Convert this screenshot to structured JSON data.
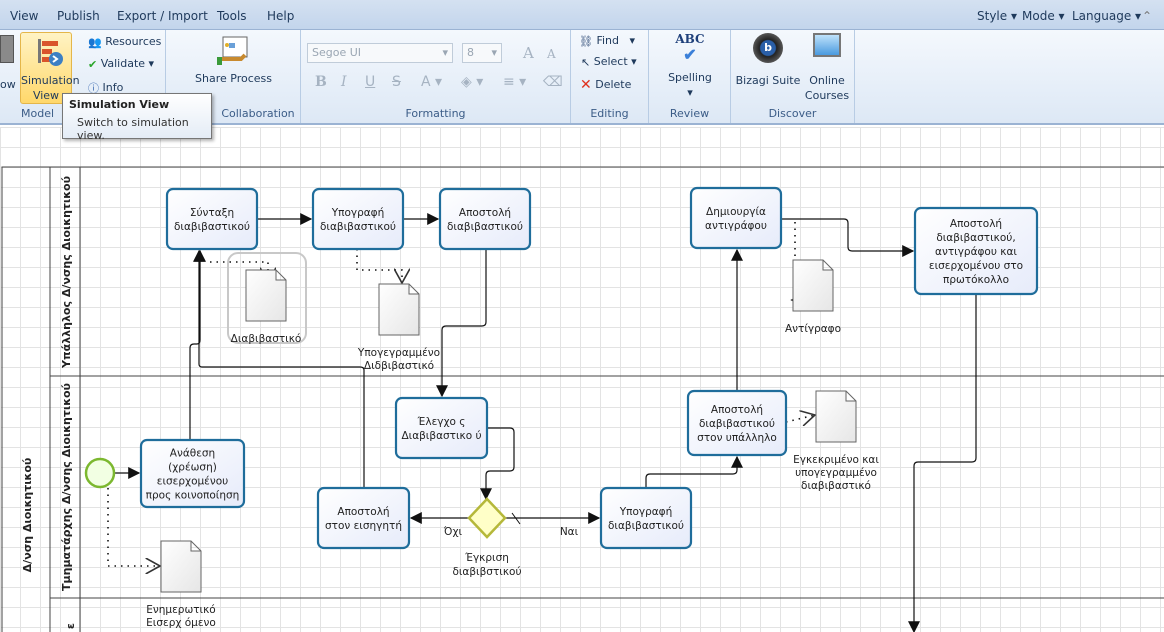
{
  "menu": {
    "items": [
      "View",
      "Publish",
      "Export / Import",
      "Tools",
      "Help"
    ],
    "right": [
      "Style",
      "Mode",
      "Language"
    ]
  },
  "ribbon": {
    "model": {
      "partial_label": "ow",
      "simulation": [
        "Simulation",
        "View"
      ],
      "resources": "Resources",
      "validate": "Validate",
      "info": "Info",
      "group": "Model"
    },
    "collaboration": {
      "share": "Share Process",
      "group": "Collaboration"
    },
    "formatting": {
      "font": "Segoe UI",
      "size": "8",
      "group": "Formatting"
    },
    "editing": {
      "find": "Find",
      "select": "Select",
      "delete": "Delete",
      "group": "Editing"
    },
    "review": {
      "spelling": "Spelling",
      "group": "Review"
    },
    "discover": {
      "suite": "Bizagi Suite",
      "courses": [
        "Online",
        "Courses"
      ],
      "group": "Discover"
    }
  },
  "tooltip": {
    "title": "Simulation View",
    "text": "Switch to simulation view."
  },
  "diagram": {
    "pool": "Δ/νση Διοικητικού",
    "lanes": [
      "Υπάλληλος Δ/νσης Διοικητικού",
      "Τμηματάρχης Δ/νσης Διοικητικού",
      "ε"
    ],
    "tasks": [
      [
        "Σύνταξη",
        "διαβιβαστικού"
      ],
      [
        "Υπογραφή",
        "διαβιβαστικού"
      ],
      [
        "Αποστολή",
        "διαβιβαστικού"
      ],
      [
        "Δημιουργία",
        "αντιγράφου"
      ],
      [
        "Αποστολή",
        "διαβιβαστικού,",
        "αντιγράφου και",
        "εισερχομένου στο",
        "πρωτόκολλο"
      ],
      [
        "Ανάθεση",
        "(χρέωση)",
        "εισερχομένου",
        "προς κοινοποίηση"
      ],
      [
        "Έλεγχο ς",
        "Διαβιβαστικο ύ"
      ],
      [
        "Αποστολή",
        "στον  εισηγητή"
      ],
      [
        "Υπογραφή",
        "διαβιβαστικού"
      ],
      [
        "Αποστολή",
        "διαβιβαστικού",
        "στον υπάλληλο"
      ]
    ],
    "documents": [
      [
        "Διαβιβαστικό"
      ],
      [
        "Υπογεγραμμένο",
        "Διδβιβαστικό"
      ],
      [
        "Αντίγραφο"
      ],
      [
        "Εγκεκριμένο και",
        "υπογεγραμμένο",
        "διαβιβαστικό"
      ],
      [
        "Ενημερωτικό",
        "Εισερχ όμενο"
      ]
    ],
    "gateway": [
      "Έγκριση",
      "διαβιβστικού"
    ],
    "flow_labels": {
      "no": "Όχι",
      "yes": "Ναι"
    },
    "colors": {
      "task_border": "#1f6d9b",
      "task_fill": "#eef2fc",
      "start": "#7cb82f",
      "gateway": "#b5b83a"
    }
  }
}
